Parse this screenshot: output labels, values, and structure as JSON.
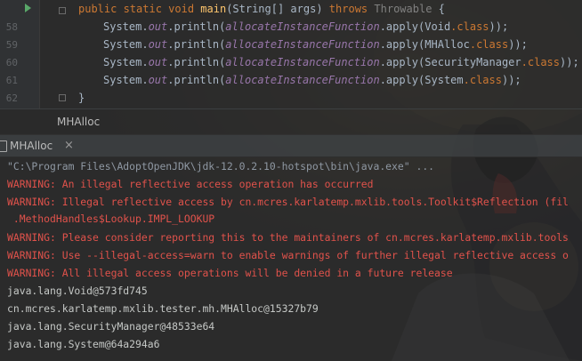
{
  "editor": {
    "line_numbers": [
      "",
      "58",
      "59",
      "60",
      "61",
      "62"
    ],
    "signature": {
      "kw": "public static void",
      "name": "main",
      "params": "(String[] args)",
      "throws_kw": "throws",
      "throwable": "Throwable",
      "brace": " {"
    },
    "print_lines": [
      {
        "prefix": "System.",
        "out": "out",
        "println": ".println(",
        "fn": "allocateInstanceFunction",
        "apply": ".apply(",
        "arg": "Void",
        "dot_class_kw": ".class",
        "suffix": "));"
      },
      {
        "prefix": "System.",
        "out": "out",
        "println": ".println(",
        "fn": "allocateInstanceFunction",
        "apply": ".apply(",
        "arg": "MHAlloc",
        "dot_class_kw": ".class",
        "suffix": "));"
      },
      {
        "prefix": "System.",
        "out": "out",
        "println": ".println(",
        "fn": "allocateInstanceFunction",
        "apply": ".apply(",
        "arg": "SecurityManager",
        "dot_class_kw": ".class",
        "suffix": "));"
      },
      {
        "prefix": "System.",
        "out": "out",
        "println": ".println(",
        "fn": "allocateInstanceFunction",
        "apply": ".apply(",
        "arg": "System",
        "dot_class_kw": ".class",
        "suffix": "));"
      }
    ],
    "closing_brace": "}"
  },
  "breadcrumb": {
    "label": "MHAlloc"
  },
  "run_tab": {
    "label": "MHAlloc",
    "close_glyph": "×"
  },
  "console": {
    "command": "\"C:\\Program Files\\AdoptOpenJDK\\jdk-12.0.2.10-hotspot\\bin\\java.exe\" ...",
    "warnings": [
      "WARNING: An illegal reflective access operation has occurred",
      "WARNING: Illegal reflective access by cn.mcres.karlatemp.mxlib.tools.Toolkit$Reflection (fil",
      " .MethodHandles$Lookup.IMPL_LOOKUP",
      "WARNING: Please consider reporting this to the maintainers of cn.mcres.karlatemp.mxlib.tools",
      "WARNING: Use --illegal-access=warn to enable warnings of further illegal reflective access o",
      "WARNING: All illegal access operations will be denied in a future release"
    ],
    "outputs": [
      "java.lang.Void@573fd745",
      "cn.mcres.karlatemp.mxlib.tester.mh.MHAlloc@15327b79",
      "java.lang.SecurityManager@48533e64",
      "java.lang.System@64a294a6"
    ]
  },
  "colors": {
    "keyword": "#cc7832",
    "method": "#ffc66d",
    "static_field": "#9876aa",
    "warning": "#e0524b",
    "plain": "#a9b7c6"
  }
}
